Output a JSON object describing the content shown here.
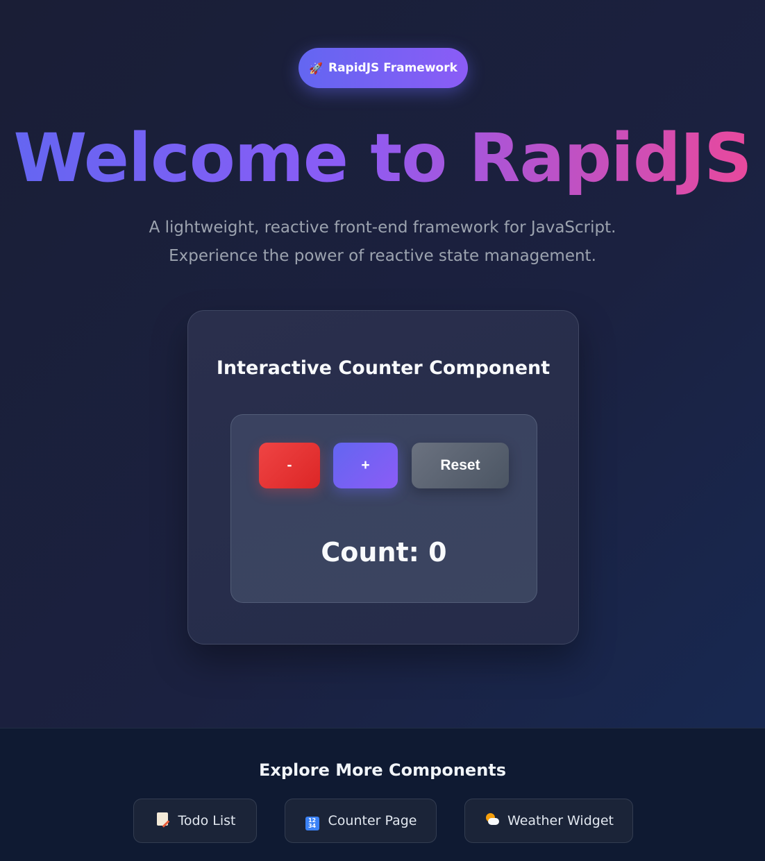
{
  "badge": {
    "icon": "rocket-icon",
    "label": "RapidJS Framework"
  },
  "hero": {
    "title": "Welcome to RapidJS",
    "subtitle_line1": "A lightweight, reactive front-end framework for JavaScript.",
    "subtitle_line2": "Experience the power of reactive state management."
  },
  "counter": {
    "title": "Interactive Counter Component",
    "decrement_label": "-",
    "increment_label": "+",
    "reset_label": "Reset",
    "count_text": "Count: 0"
  },
  "footer": {
    "title": "Explore More Components",
    "links": [
      {
        "icon": "memo-icon",
        "label": "Todo List"
      },
      {
        "icon": "numbers-icon",
        "label": "Counter Page"
      },
      {
        "icon": "sun-cloud-icon",
        "label": "Weather Widget"
      }
    ]
  },
  "colors": {
    "accent_start": "#6366f1",
    "accent_mid": "#8b5cf6",
    "accent_end": "#ec4899",
    "danger": "#ef4444",
    "neutral": "#6b7280",
    "background": "#1b2140"
  }
}
